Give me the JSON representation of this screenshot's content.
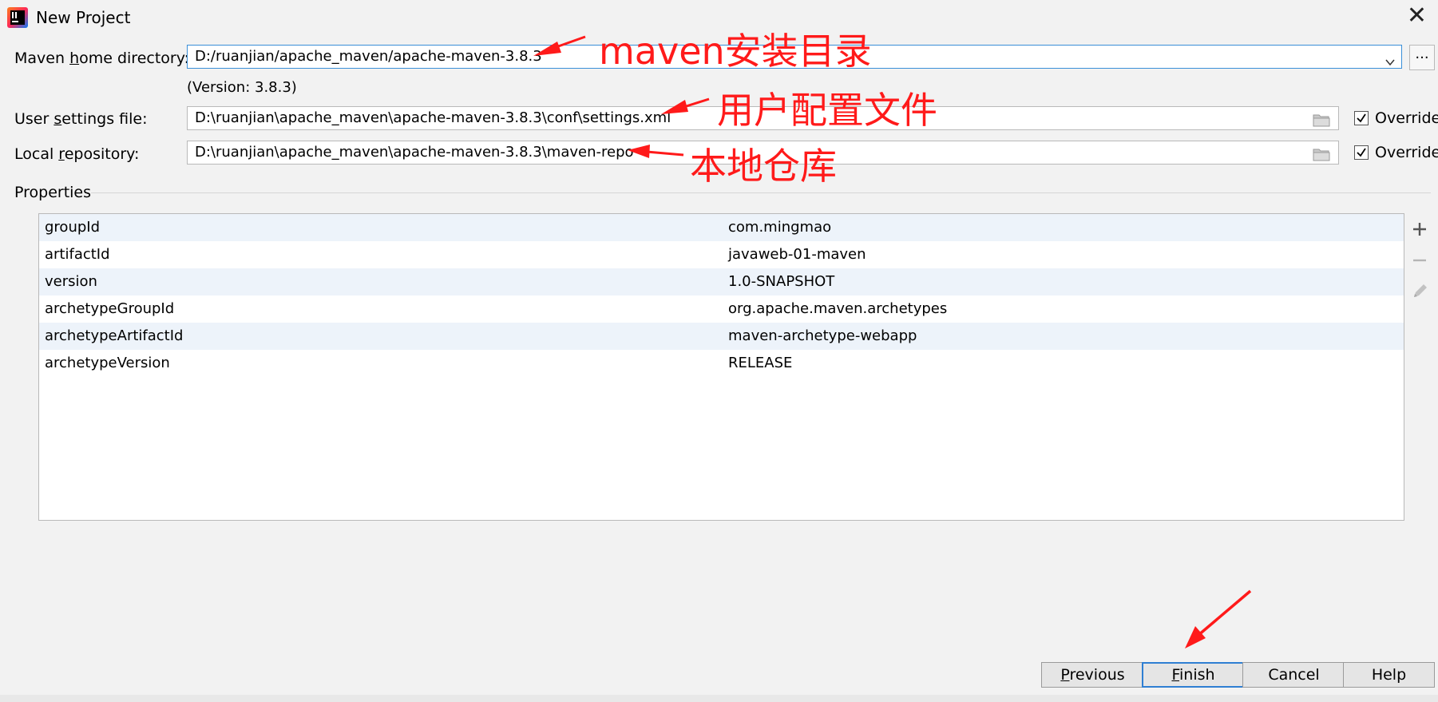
{
  "window": {
    "title": "New Project"
  },
  "maven_home": {
    "label_pre": "Maven ",
    "label_u": "h",
    "label_post": "ome directory:",
    "value": "D:/ruanjian/apache_maven/apache-maven-3.8.3",
    "version_note": "(Version: 3.8.3)",
    "browse_label": "..."
  },
  "user_settings": {
    "label_pre": "User ",
    "label_u": "s",
    "label_post": "ettings file:",
    "value": "D:\\ruanjian\\apache_maven\\apache-maven-3.8.3\\conf\\settings.xml",
    "override_label": "Override",
    "override_checked": true
  },
  "local_repo": {
    "label_pre": "Local ",
    "label_u": "r",
    "label_post": "epository:",
    "value": "D:\\ruanjian\\apache_maven\\apache-maven-3.8.3\\maven-repo",
    "override_label": "Override",
    "override_checked": true
  },
  "properties": {
    "title": "Properties",
    "rows": [
      {
        "key": "groupId",
        "value": "com.mingmao"
      },
      {
        "key": "artifactId",
        "value": "javaweb-01-maven"
      },
      {
        "key": "version",
        "value": "1.0-SNAPSHOT"
      },
      {
        "key": "archetypeGroupId",
        "value": "org.apache.maven.archetypes"
      },
      {
        "key": "archetypeArtifactId",
        "value": "maven-archetype-webapp"
      },
      {
        "key": "archetypeVersion",
        "value": "RELEASE"
      }
    ]
  },
  "buttons": {
    "previous_u": "P",
    "previous_rest": "revious",
    "finish_u": "F",
    "finish_rest": "inish",
    "cancel": "Cancel",
    "help": "Help"
  },
  "annotations": {
    "maven_home": "maven安装目录",
    "user_settings": "用户配置文件",
    "local_repo": "本地仓库"
  },
  "colors": {
    "annotation": "#ff1a1a",
    "focus": "#2f7fd3",
    "row_alt": "#edf3fa"
  }
}
